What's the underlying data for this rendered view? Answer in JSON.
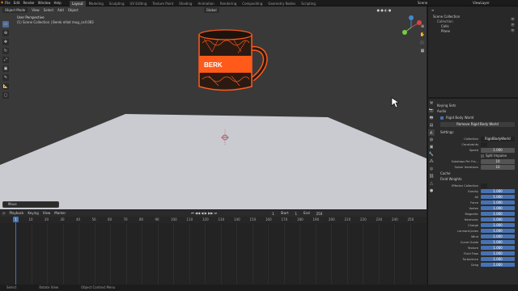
{
  "menus": [
    "File",
    "Edit",
    "Render",
    "Window",
    "Help"
  ],
  "workspaces": [
    "Layout",
    "Modeling",
    "Sculpting",
    "UV Editing",
    "Texture Paint",
    "Shading",
    "Animation",
    "Rendering",
    "Compositing",
    "Geometry Nodes",
    "Scripting"
  ],
  "active_workspace": "Layout",
  "top_right": {
    "scene": "Scene",
    "view_layer": "ViewLayer"
  },
  "viewport": {
    "mode": "Object Mode",
    "menus": [
      "View",
      "Select",
      "Add",
      "Object"
    ],
    "transform": "Global",
    "title": "User Perspective",
    "subtitle": "(1) Scene Collection | Berek elliot mug_call.083",
    "mug_text": "BERK",
    "last_op": "Move"
  },
  "tools": [
    "select",
    "cursor",
    "move",
    "rotate",
    "scale",
    "transform",
    "annotate",
    "measure",
    "add"
  ],
  "outliner": {
    "items": [
      {
        "label": "Scene Collection",
        "indent": 0
      },
      {
        "label": "Collection",
        "indent": 1
      },
      {
        "label": "Cells",
        "indent": 2
      },
      {
        "label": "Plane",
        "indent": 2
      }
    ]
  },
  "properties": {
    "keying_sets": "Keying Sets",
    "audio": "Audio",
    "rigid_body_world_checkbox": "Rigid Body World",
    "remove_button": "Remove Rigid Body World",
    "settings": "Settings",
    "collection_label": "Collection",
    "collection_value": "RigidBodyWorld",
    "constraints_label": "Constraints",
    "speed_label": "Speed",
    "speed_value": "1.000",
    "split_impulse": "Split Impulse",
    "substeps_label": "Substeps Per Fra...",
    "substeps_value": "10",
    "solver_label": "Solver Iterations",
    "solver_value": "10",
    "cache": "Cache",
    "field_weights": "Field Weights",
    "effector_label": "Effector Collection",
    "weights": [
      {
        "label": "Gravity",
        "value": "1.000"
      },
      {
        "label": "All",
        "value": "1.000"
      },
      {
        "label": "Force",
        "value": "1.000"
      },
      {
        "label": "Vortex",
        "value": "1.000"
      },
      {
        "label": "Magnetic",
        "value": "1.000"
      },
      {
        "label": "Harmonic",
        "value": "1.000"
      },
      {
        "label": "Charge",
        "value": "1.000"
      },
      {
        "label": "Lennard-Jones",
        "value": "1.000"
      },
      {
        "label": "Wind",
        "value": "1.000"
      },
      {
        "label": "Curve Guide",
        "value": "1.000"
      },
      {
        "label": "Texture",
        "value": "1.000"
      },
      {
        "label": "Fluid Flow",
        "value": "1.000"
      },
      {
        "label": "Turbulence",
        "value": "1.000"
      },
      {
        "label": "Drag",
        "value": "1.000"
      }
    ]
  },
  "timeline": {
    "menus": [
      "Playback",
      "Keying",
      "View",
      "Marker"
    ],
    "current_frame": "1",
    "start_label": "Start",
    "start": "1",
    "end_label": "End",
    "end": "250",
    "ticks": [
      "0",
      "10",
      "20",
      "30",
      "40",
      "50",
      "60",
      "70",
      "80",
      "90",
      "100",
      "110",
      "120",
      "130",
      "140",
      "150",
      "160",
      "170",
      "180",
      "190",
      "200",
      "210",
      "220",
      "230",
      "240",
      "250"
    ],
    "playhead": "1"
  },
  "statusbar": [
    "Select",
    "Rotate View",
    "Object Context Menu"
  ],
  "colors": {
    "accent": "#4772b3",
    "mug_orange": "#ff5a1a",
    "ground": "#c9cbd1"
  }
}
